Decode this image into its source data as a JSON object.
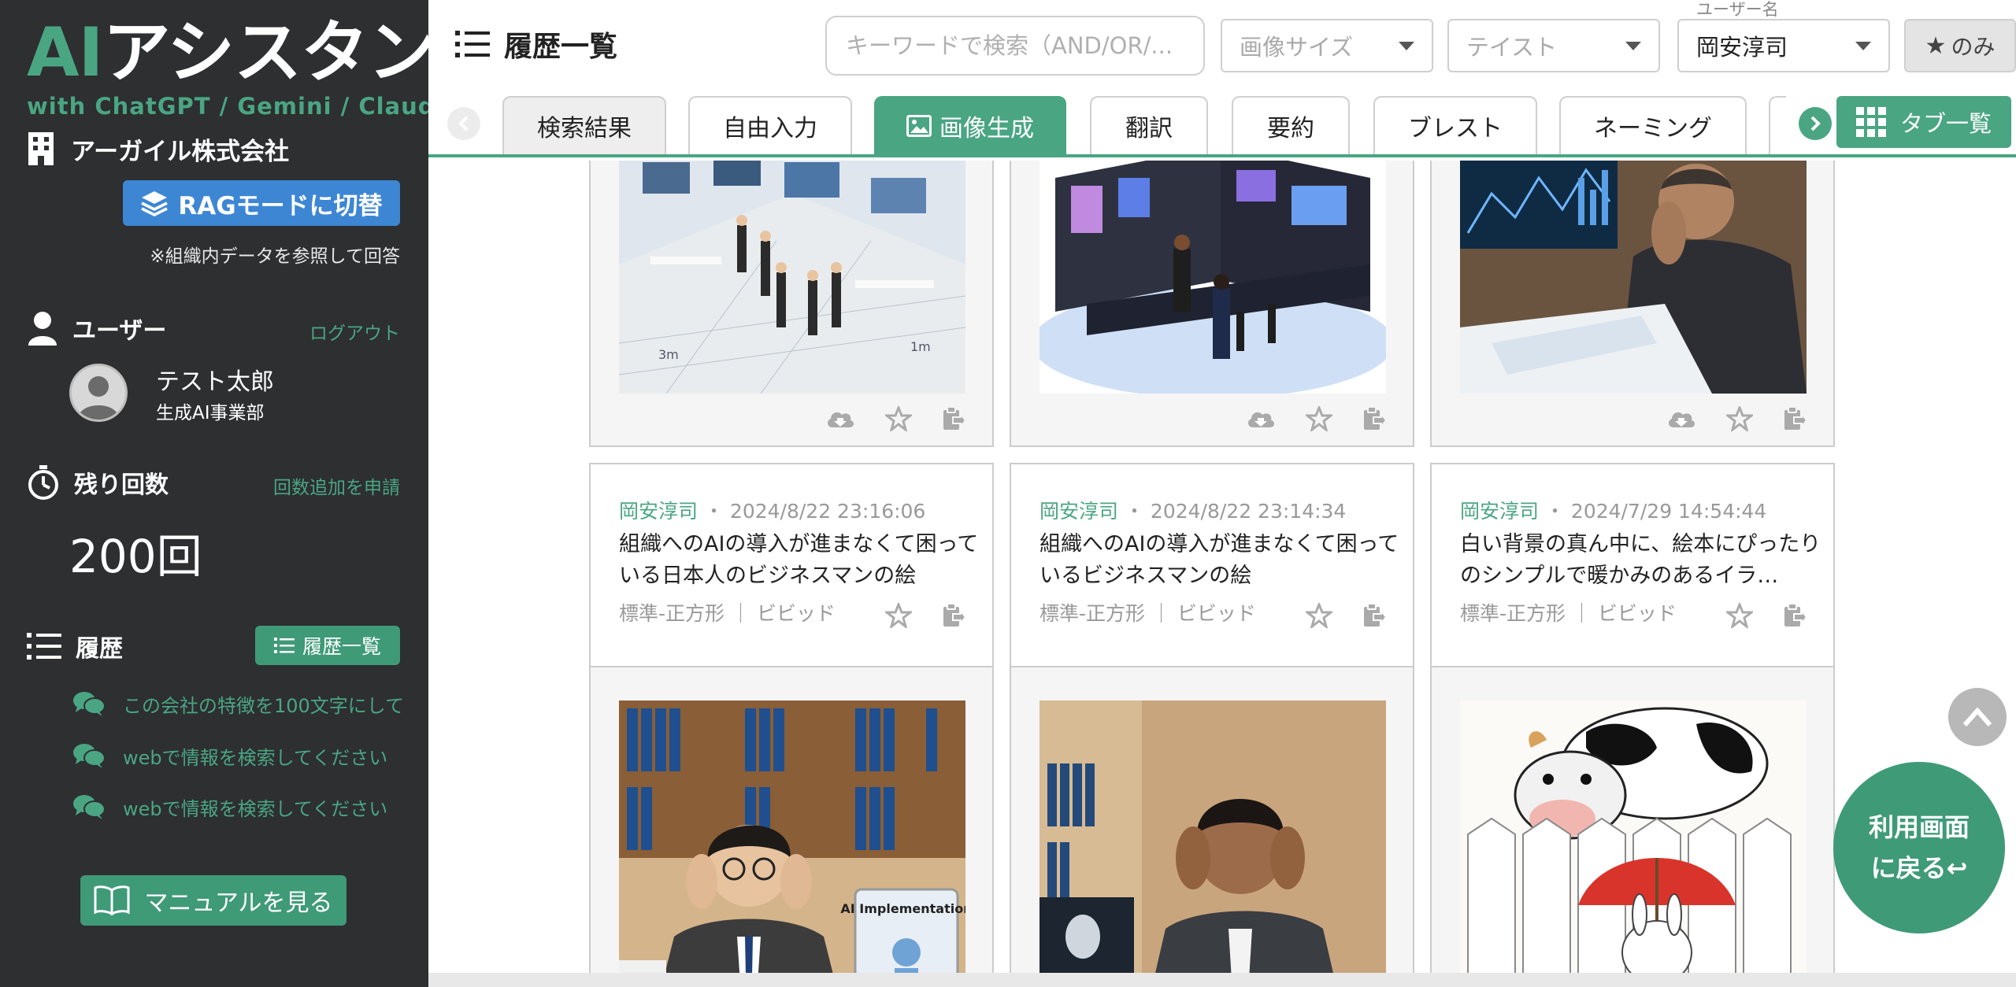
{
  "sidebar": {
    "logo_ai": "AI",
    "logo_rest": "アシスタント",
    "logo_sub": "with ChatGPT / Gemini / Claude",
    "company": "アーガイル株式会社",
    "rag_button": "RAGモードに切替",
    "rag_note": "※組織内データを参照して回答",
    "user_section": "ユーザー",
    "logout": "ログアウト",
    "user_name": "テスト太郎",
    "user_dept": "生成AI事業部",
    "remaining_section": "残り回数",
    "request_more": "回数追加を申請",
    "remaining_count": "200回",
    "history_section": "履歴",
    "history_button": "履歴一覧",
    "history_items": [
      "この会社の特徴を100文字にして",
      "webで情報を検索してください",
      "webで情報を検索してください"
    ],
    "manual_button": "マニュアルを見る"
  },
  "header": {
    "page_title": "履歴一覧",
    "search_placeholder": "キーワードで検索（AND/OR/...",
    "image_size_placeholder": "画像サイズ",
    "taste_placeholder": "テイスト",
    "user_label": "ユーザー名",
    "user_selected": "岡安淳司",
    "star_only": "のみ",
    "tabs": [
      "検索結果",
      "自由入力",
      "画像生成",
      "翻訳",
      "要約",
      "ブレスト",
      "ネーミング"
    ],
    "tab_list_button": "タブ一覧"
  },
  "cards": [
    {
      "author": "岡安淳司",
      "datetime": "2024/8/22 23:16:06",
      "prompt": "組織へのAIの導入が進まなくて困っている日本人のビジネスマンの絵",
      "tags": "標準-正方形 ｜ ビビッド"
    },
    {
      "author": "岡安淳司",
      "datetime": "2024/8/22 23:14:34",
      "prompt": "組織へのAIの導入が進まなくて困っているビジネスマンの絵",
      "tags": "標準-正方形 ｜ ビビッド"
    },
    {
      "author": "岡安淳司",
      "datetime": "2024/7/29 14:54:44",
      "prompt": "白い背景の真ん中に、絵本にぴったりのシンプルで暖かみのあるイラ…",
      "tags": "標準-正方形 ｜ ビビッド"
    }
  ],
  "thumb_texts": {
    "scale_a": "3m",
    "scale_b": "1m",
    "ai_book": "AI Implementation"
  },
  "floating": {
    "back_line1": "利用画面",
    "back_line2": "に戻る↩"
  },
  "colors": {
    "accent": "#4aa583",
    "sidebar_bg": "#2d2f31",
    "rag_blue": "#3d86d4"
  }
}
